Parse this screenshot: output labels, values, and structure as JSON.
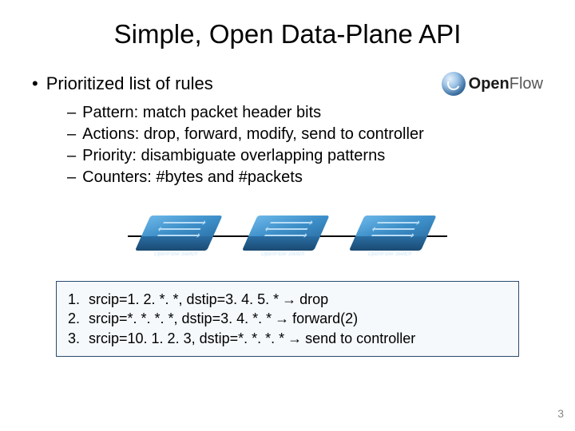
{
  "title": "Simple, Open Data-Plane API",
  "logo": {
    "brand": "Open",
    "suffix": "Flow"
  },
  "main_bullet": "Prioritized list of rules",
  "sub_bullets": [
    "Pattern: match packet header bits",
    "Actions: drop, forward, modify, send to controller",
    "Priority: disambiguate overlapping patterns",
    "Counters: #bytes and #packets"
  ],
  "switch_label": "OpenFlow Switch",
  "rules": [
    {
      "n": "1.",
      "match": "srcip=1. 2. *. *, dstip=3. 4. 5. *",
      "action": "drop"
    },
    {
      "n": "2.",
      "match": "srcip=*. *. *. *, dstip=3. 4. *. *",
      "action": "forward(2)"
    },
    {
      "n": "3.",
      "match": "srcip=10. 1. 2. 3, dstip=*. *. *. *",
      "action": "send to controller"
    }
  ],
  "arrow": "→",
  "slide_number": "3"
}
